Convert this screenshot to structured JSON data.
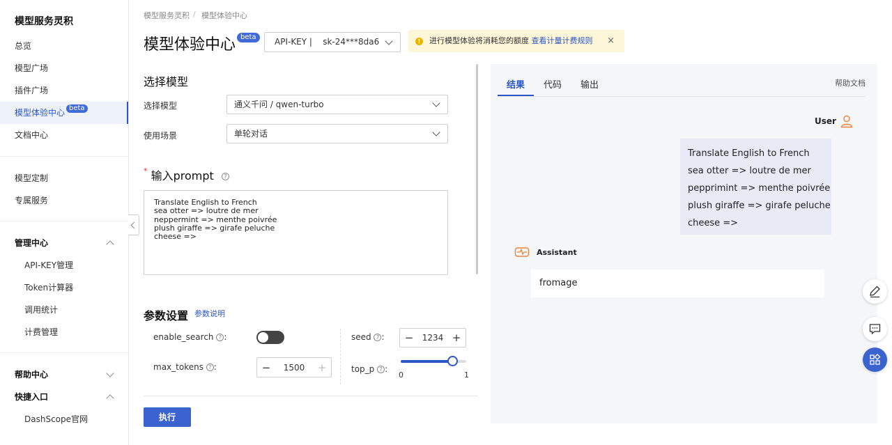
{
  "sidebar": {
    "brand": "模型服务灵积",
    "items": [
      {
        "label": "总览"
      },
      {
        "label": "模型广场"
      },
      {
        "label": "插件广场"
      },
      {
        "label": "模型体验中心",
        "badge": "beta"
      },
      {
        "label": "文档中心"
      },
      {
        "label": "模型定制"
      },
      {
        "label": "专属服务"
      }
    ],
    "manage": {
      "label": "管理中心",
      "items": [
        {
          "label": "API-KEY管理"
        },
        {
          "label": "Token计算器"
        },
        {
          "label": "调用统计"
        },
        {
          "label": "计费管理"
        }
      ]
    },
    "help": {
      "label": "帮助中心"
    },
    "shortcut": {
      "label": "快捷入口",
      "items": [
        {
          "label": "DashScope官网"
        }
      ]
    }
  },
  "breadcrumb": {
    "root": "模型服务灵积",
    "sep": "/",
    "current": "模型体验中心"
  },
  "header": {
    "title": "模型体验中心",
    "badge": "beta",
    "apikey": "API-KEY |    sk-24***8da6",
    "notice": {
      "text": "进行模型体验将消耗您的额度 ",
      "link": "查看计量计费规则",
      "close": "×"
    }
  },
  "left": {
    "select_heading": "选择模型",
    "model_label": "选择模型",
    "model_value": "通义千问 / qwen-turbo",
    "scene_label": "使用场景",
    "scene_value": "单轮对话",
    "prompt_heading": "输入prompt",
    "required_mark": "*",
    "prompt_text": "Translate English to French\nsea otter => loutre de mer\nneppermint => menthe poivrée\nplush giraffe => girafe peluche\ncheese =>",
    "params_heading": "参数设置",
    "params_link": "参数说明",
    "params": {
      "enable_search": {
        "label": "enable_search",
        "on": false
      },
      "max_tokens": {
        "label": "max_tokens",
        "value": "1500"
      },
      "seed": {
        "label": "seed",
        "value": "1234"
      },
      "top_p": {
        "label": "top_p",
        "min": "0",
        "max": "1",
        "value": 0.8
      }
    },
    "run_button": "执行"
  },
  "right": {
    "tabs": [
      {
        "label": "结果"
      },
      {
        "label": "代码"
      },
      {
        "label": "输出"
      }
    ],
    "help_link": "帮助文档",
    "user_name": "User",
    "user_message": "Translate English to French\nsea otter => loutre de mer\npepprimint => menthe poivrée\nplush giraffe => girafe peluche\ncheese =>",
    "assistant_name": "Assistant",
    "assistant_message": "fromage"
  },
  "ops": {
    "minus": "−",
    "plus": "+",
    "colon": ":",
    "help": "?"
  },
  "colors": {
    "accent": "#2a56c6",
    "notice_bg": "#fdf6d8",
    "user_bubble": "#e8ebf6",
    "assistant_icon": "#e8843a"
  }
}
